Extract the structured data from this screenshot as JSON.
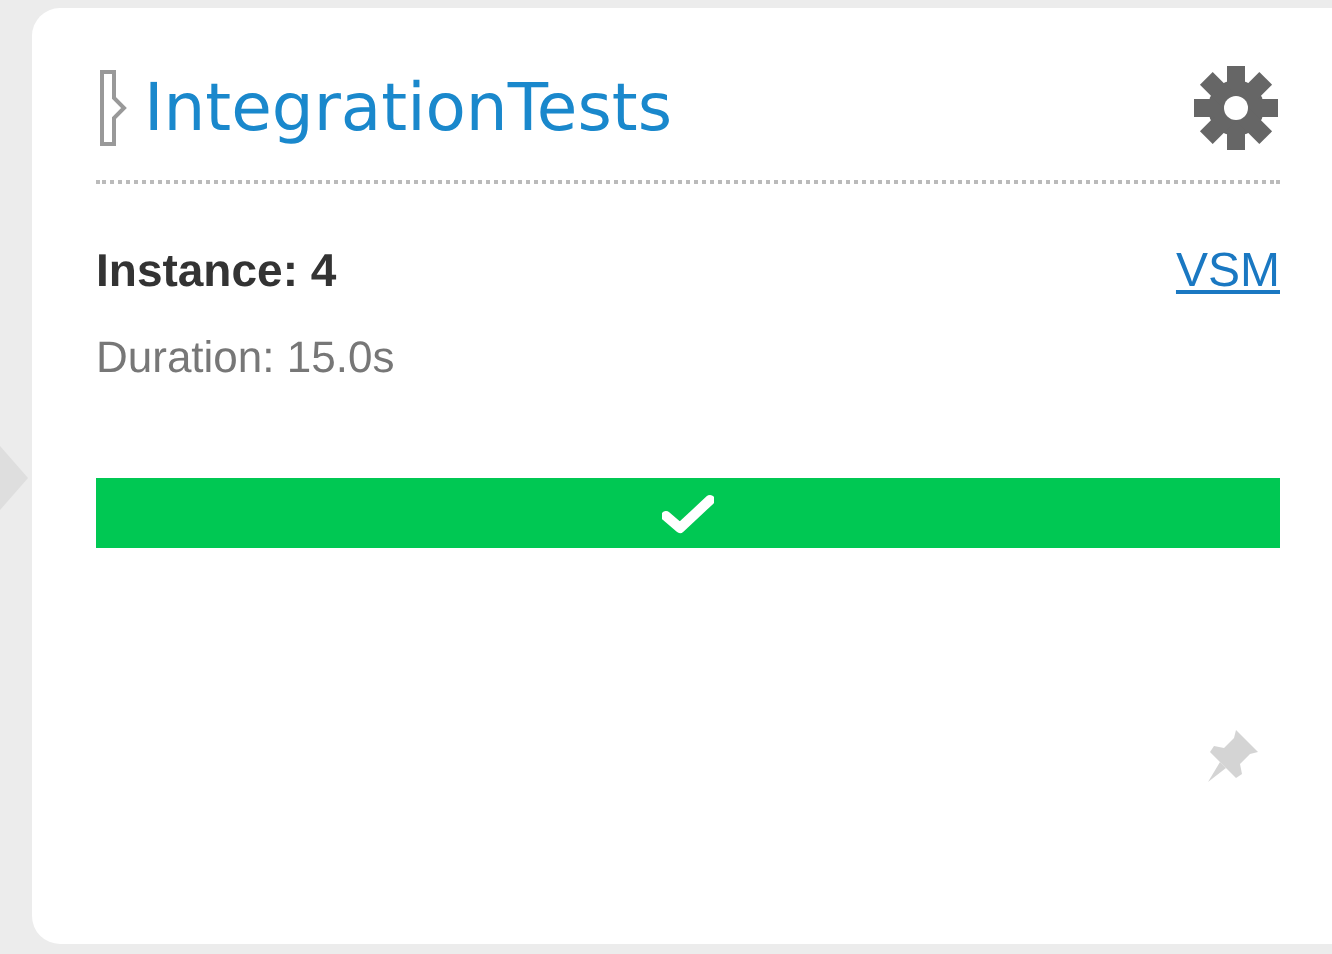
{
  "pipeline": {
    "name": "IntegrationTests"
  },
  "instance": {
    "label": "Instance: 4",
    "duration": "Duration: 15.0s",
    "link": "VSM"
  },
  "stages": [
    {
      "passed": true
    }
  ]
}
